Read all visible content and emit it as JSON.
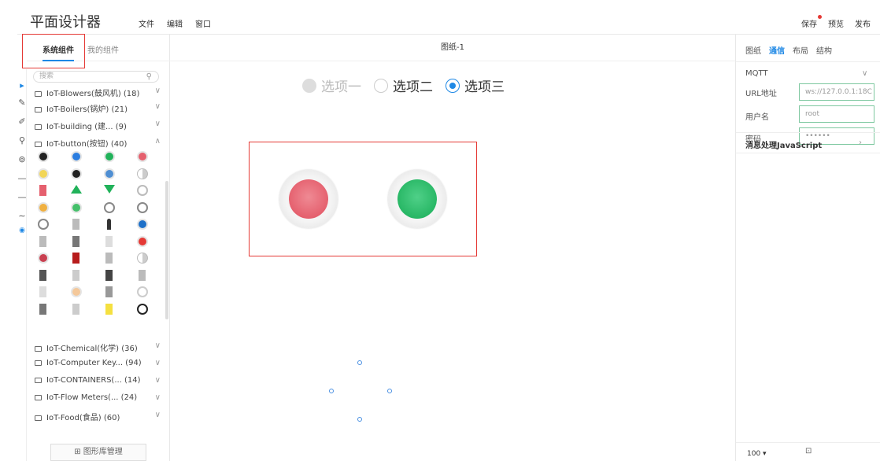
{
  "header": {
    "app_title": "平面设计器",
    "menu": [
      "文件",
      "编辑",
      "窗口"
    ],
    "save_label": "保存",
    "preview_label": "预览",
    "publish_label": "发布"
  },
  "left_panel": {
    "tab_system": "系统组件",
    "tab_mine": "我的组件",
    "search_placeholder": "搜索",
    "categories_top": [
      "IoT-Blowers(鼓风机) (18)",
      "IoT-Boilers(锅炉) (21)",
      "IoT-building (建...  (9)",
      "IoT-button(按钮) (40)"
    ],
    "categories_bottom": [
      "IoT-Chemical(化学) (36)",
      "IoT-Computer Key...  (94)",
      "IoT-CONTAINERS(...  (14)",
      "IoT-Flow Meters(...  (24)",
      "IoT-Food(食品) (60)"
    ],
    "library_button": "图形库管理"
  },
  "canvas": {
    "title": "图纸-1",
    "radio_options": [
      "选项一",
      "选项二",
      "选项三"
    ],
    "radio_selected": "选项三",
    "radio_disabled": "选项一"
  },
  "right_panel": {
    "tabs": [
      "图纸",
      "通信",
      "布局",
      "结构"
    ],
    "active_tab": "通信",
    "section_mqtt": "MQTT",
    "url_label": "URL地址",
    "url_value": "ws://127.0.0.1:18C",
    "user_label": "用户名",
    "user_value": "root",
    "password_label": "密码",
    "password_value": "••••••",
    "message_section": "消息处理JavaScript",
    "zoom_value": "100 ▾"
  },
  "colors": {
    "accent": "#1e88e5",
    "highlight_box": "#e53935",
    "red_button": "#e5606e",
    "green_button": "#28b765"
  }
}
